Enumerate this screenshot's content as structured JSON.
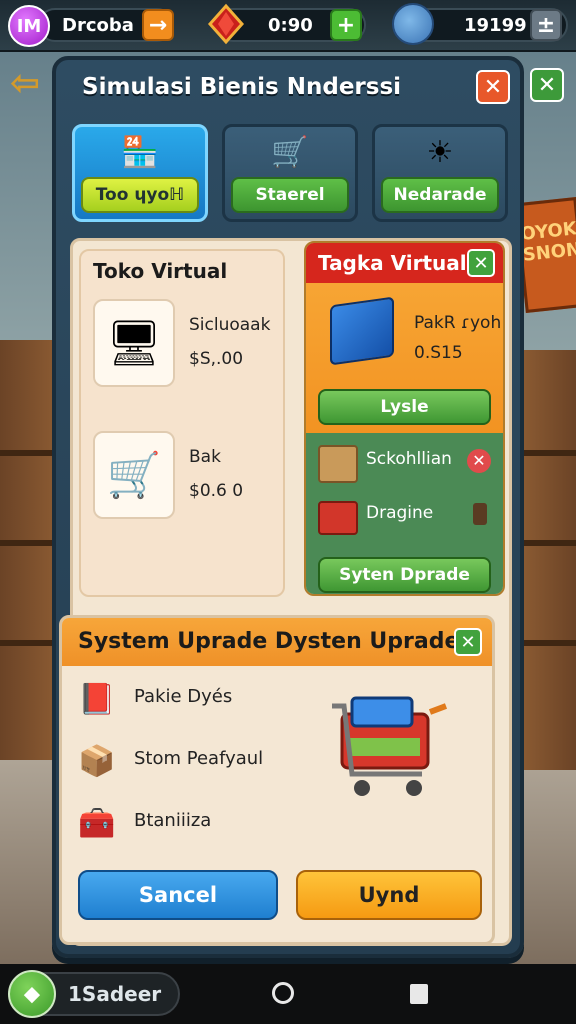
{
  "topbar": {
    "avatar_letter": "IM",
    "player_name": "Drcoba",
    "timer": "0:90",
    "coins": "19199",
    "add_symbol": "+",
    "menu_symbol": "±"
  },
  "panel": {
    "title": "Simulasi Bienis Nnderssi",
    "close_symbol": "✕",
    "tabs": [
      {
        "label": "Too ɥyoℍ",
        "icon": "store-icon",
        "active": true
      },
      {
        "label": "Staerel",
        "icon": "cart-icon",
        "active": false
      },
      {
        "label": "Nedarade",
        "icon": "sun-gear-icon",
        "active": false
      }
    ]
  },
  "toko_card": {
    "title": "Toko Virtual",
    "items": [
      {
        "name": "Sicluoaak",
        "price": "$S,.00",
        "icon": "monitor-icon"
      },
      {
        "name": "Bak",
        "price": "$0.6 0",
        "icon": "cart-icon"
      }
    ]
  },
  "tagka_card": {
    "title": "Tagka Virtual",
    "product_name": "PakR ɾyoh",
    "product_price": "0.S15",
    "buy_button": "Lysle",
    "rows": [
      {
        "label": "Sckohllian",
        "icon": "box-icon",
        "status_icon": "red-cancel-icon"
      },
      {
        "label": "Dragine",
        "icon": "open-box-icon",
        "status_icon": "bin-icon"
      }
    ],
    "upgrade_button": "Syten Dprade"
  },
  "upgrade_panel": {
    "title": "System Uprade Dysten Uprade",
    "items": [
      {
        "label": "Pakie Dyés",
        "icon": "red-box-icon"
      },
      {
        "label": "Stom Peafyaul",
        "icon": "crate-icon"
      },
      {
        "label": "Btaniiiza",
        "icon": "green-toolbox-icon"
      }
    ],
    "cancel_button": "Sancel",
    "confirm_button": "Uynd"
  },
  "navbar": {
    "pill_label": "1Sadeer"
  },
  "background": {
    "sign_text": "OYOK SNONE"
  },
  "colors": {
    "accent_green": "#41a23d",
    "accent_orange": "#f29322",
    "accent_red": "#d6261d",
    "accent_blue": "#1f8fe0",
    "avatar_purple": "#a11cc9"
  }
}
